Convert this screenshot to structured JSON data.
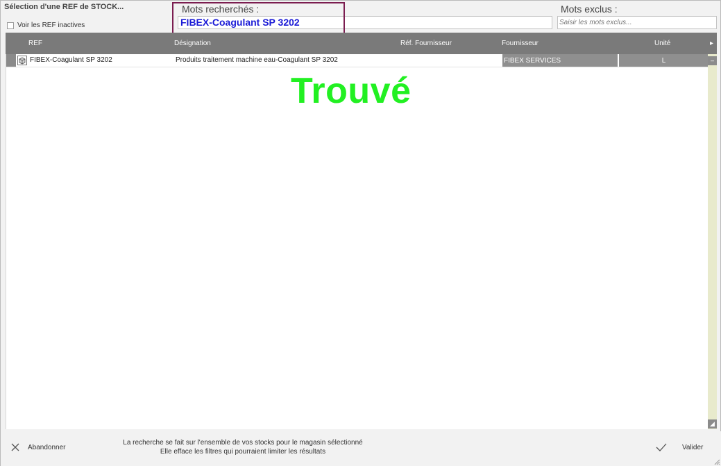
{
  "dialog": {
    "title": "Sélection d'une REF de STOCK...",
    "show_inactive_label": "Voir les REF inactives"
  },
  "search": {
    "label": "Mots recherchés :",
    "value": "FIBEX-Coagulant SP 3202"
  },
  "exclude": {
    "label": "Mots exclus :",
    "placeholder": "Saisir les mots exclus..."
  },
  "grid": {
    "columns": [
      "REF",
      "Désignation",
      "Réf. Fournisseur",
      "Fournisseur",
      "Unité"
    ],
    "rows": [
      {
        "ref": "FIBEX-Coagulant SP 3202",
        "designation": "Produits traitement machine eau-Coagulant SP 3202",
        "ref_fournisseur": "",
        "fournisseur": "FIBEX SERVICES",
        "unite": "L"
      }
    ]
  },
  "annotation": {
    "text": "Trouvé",
    "color": "#22f022"
  },
  "footer": {
    "cancel_label": "Abandonner",
    "info_line1": "La recherche se fait sur l'ensemble de vos stocks pour le magasin sélectionné",
    "info_line2": "Elle efface les filtres qui pourraient limiter les résultats",
    "validate_label": "Valider"
  },
  "colors": {
    "search_text": "#1a1ad6",
    "highlight_border": "#7b1d50",
    "header_bg": "#7a7a7a"
  }
}
